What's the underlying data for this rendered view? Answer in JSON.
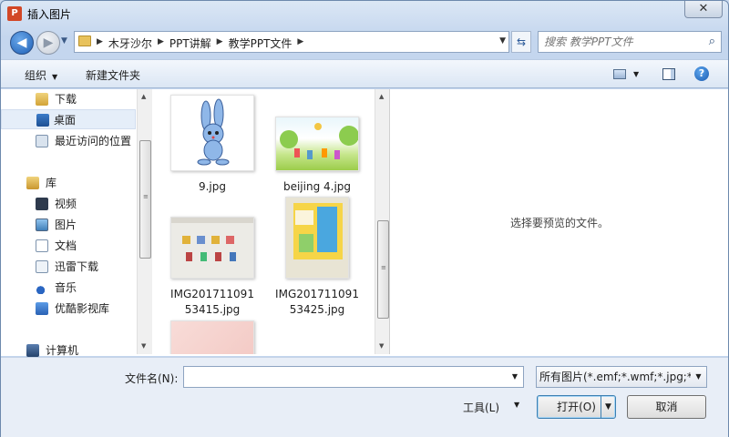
{
  "window": {
    "title": "插入图片",
    "close_label": "✕"
  },
  "nav": {
    "breadcrumbs": [
      "木牙沙尔",
      "PPT讲解",
      "教学PPT文件"
    ],
    "search_placeholder": "搜索 教学PPT文件"
  },
  "toolbar": {
    "organize_label": "组织",
    "new_folder_label": "新建文件夹"
  },
  "sidebar": {
    "items": [
      {
        "label": "下载",
        "icon": "download-folder-icon"
      },
      {
        "label": "桌面",
        "icon": "desktop-icon",
        "selected": true
      },
      {
        "label": "最近访问的位置",
        "icon": "recent-places-icon"
      },
      {
        "label": "库",
        "icon": "library-icon"
      },
      {
        "label": "视频",
        "icon": "videos-icon"
      },
      {
        "label": "图片",
        "icon": "pictures-icon"
      },
      {
        "label": "文档",
        "icon": "documents-icon"
      },
      {
        "label": "迅雷下载",
        "icon": "thunder-download-icon"
      },
      {
        "label": "音乐",
        "icon": "music-icon"
      },
      {
        "label": "优酷影视库",
        "icon": "youku-library-icon"
      },
      {
        "label": "计算机",
        "icon": "computer-icon"
      }
    ]
  },
  "files": [
    {
      "name_line1": "9.jpg",
      "name_line2": ""
    },
    {
      "name_line1": "beijing 4.jpg",
      "name_line2": ""
    },
    {
      "name_line1": "IMG201711091",
      "name_line2": "53415.jpg"
    },
    {
      "name_line1": "IMG201711091",
      "name_line2": "53425.jpg"
    },
    {
      "name_line1": "",
      "name_line2": ""
    }
  ],
  "preview": {
    "message": "选择要预览的文件。"
  },
  "footer": {
    "filename_label": "文件名(N):",
    "filename_value": "",
    "filter_value": "所有图片(*.emf;*.wmf;*.jpg;*.jpeg)",
    "tools_label": "工具(L)",
    "open_label": "打开(O)",
    "cancel_label": "取消"
  }
}
